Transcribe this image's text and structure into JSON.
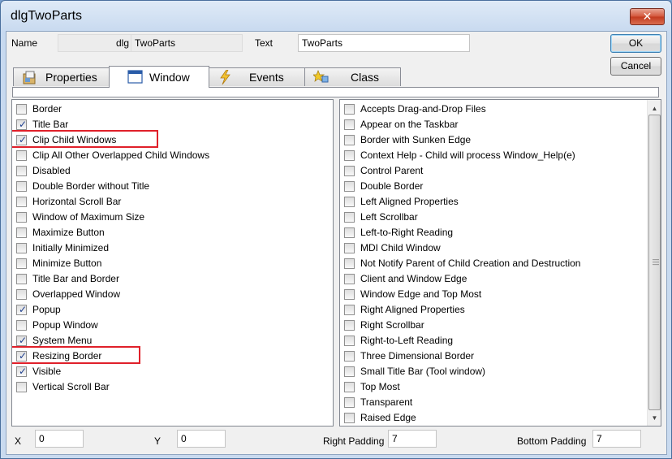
{
  "window": {
    "title": "dlgTwoParts",
    "close_glyph": "✕"
  },
  "header": {
    "name_label": "Name",
    "name_prefix": "dlg",
    "name_value": "TwoParts",
    "text_label": "Text",
    "text_value": "TwoParts"
  },
  "buttons": {
    "ok": "OK",
    "cancel": "Cancel"
  },
  "tabs": [
    {
      "label": "Properties",
      "icon": "properties-icon",
      "active": false
    },
    {
      "label": "Window",
      "icon": "window-icon",
      "active": true
    },
    {
      "label": "Events",
      "icon": "lightning-icon",
      "active": false
    },
    {
      "label": "Class",
      "icon": "class-icon",
      "active": false
    }
  ],
  "left_list": [
    {
      "label": "Border",
      "checked": false
    },
    {
      "label": "Title Bar",
      "checked": true
    },
    {
      "label": "Clip Child Windows",
      "checked": true,
      "highlighted": true
    },
    {
      "label": "Clip All Other Overlapped Child Windows",
      "checked": false
    },
    {
      "label": "Disabled",
      "checked": false
    },
    {
      "label": "Double Border without Title",
      "checked": false
    },
    {
      "label": "Horizontal Scroll Bar",
      "checked": false
    },
    {
      "label": "Window of Maximum Size",
      "checked": false
    },
    {
      "label": "Maximize Button",
      "checked": false
    },
    {
      "label": "Initially Minimized",
      "checked": false
    },
    {
      "label": "Minimize Button",
      "checked": false
    },
    {
      "label": "Title Bar and Border",
      "checked": false
    },
    {
      "label": "Overlapped Window",
      "checked": false
    },
    {
      "label": "Popup",
      "checked": true
    },
    {
      "label": "Popup Window",
      "checked": false
    },
    {
      "label": "System Menu",
      "checked": true
    },
    {
      "label": "Resizing Border",
      "checked": true,
      "highlighted": true
    },
    {
      "label": "Visible",
      "checked": true
    },
    {
      "label": "Vertical Scroll Bar",
      "checked": false
    }
  ],
  "right_list": [
    {
      "label": "Accepts Drag-and-Drop Files",
      "checked": false
    },
    {
      "label": "Appear on the Taskbar",
      "checked": false
    },
    {
      "label": "Border with Sunken Edge",
      "checked": false
    },
    {
      "label": "Context Help - Child will process Window_Help(e)",
      "checked": false
    },
    {
      "label": "Control Parent",
      "checked": false
    },
    {
      "label": "Double Border",
      "checked": false
    },
    {
      "label": "Left Aligned Properties",
      "checked": false
    },
    {
      "label": "Left Scrollbar",
      "checked": false
    },
    {
      "label": "Left-to-Right Reading",
      "checked": false
    },
    {
      "label": "MDI Child Window",
      "checked": false
    },
    {
      "label": "Not Notify Parent of Child Creation and Destruction",
      "checked": false
    },
    {
      "label": "Client and Window Edge",
      "checked": false
    },
    {
      "label": "Window Edge and Top Most",
      "checked": false
    },
    {
      "label": "Right Aligned Properties",
      "checked": false
    },
    {
      "label": "Right Scrollbar",
      "checked": false
    },
    {
      "label": "Right-to-Left Reading",
      "checked": false
    },
    {
      "label": "Three Dimensional Border",
      "checked": false
    },
    {
      "label": "Small Title Bar (Tool window)",
      "checked": false
    },
    {
      "label": "Top Most",
      "checked": false
    },
    {
      "label": "Transparent",
      "checked": false
    },
    {
      "label": "Raised Edge",
      "checked": false
    }
  ],
  "footer": {
    "x_label": "X",
    "x_value": "0",
    "y_label": "Y",
    "y_value": "0",
    "right_padding_label": "Right Padding",
    "right_padding_value": "7",
    "bottom_padding_label": "Bottom Padding",
    "bottom_padding_value": "7"
  },
  "colors": {
    "highlight": "#e0202a",
    "tick": "#1e3f8f"
  }
}
